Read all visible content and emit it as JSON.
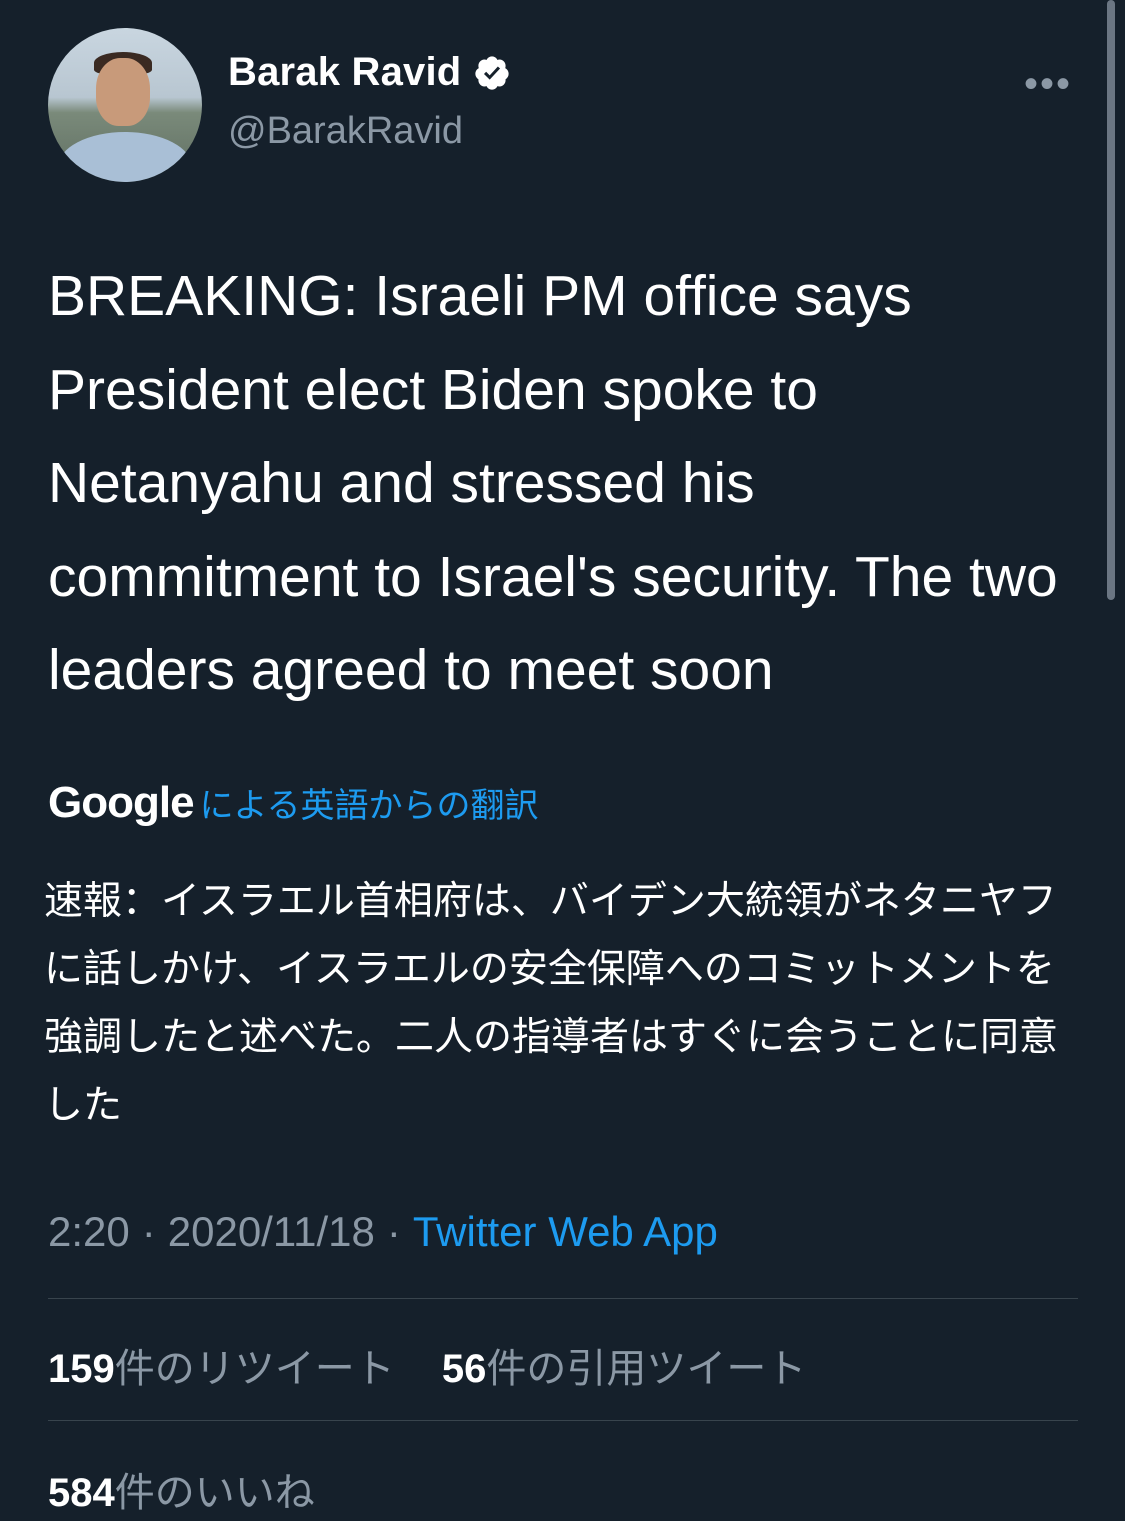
{
  "author": {
    "name": "Barak Ravid",
    "handle": "@BarakRavid"
  },
  "menu": {
    "more_label": "•••"
  },
  "tweet": {
    "text": "BREAKING: Israeli PM office says President elect Biden spoke to Netanyahu and stressed his commitment to Israel's security. The two leaders agreed to meet soon"
  },
  "translation": {
    "provider": "Google",
    "link_label": "による英語からの翻訳",
    "text": "速報：イスラエル首相府は、バイデン大統領がネタニヤフに話しかけ、イスラエルの安全保障へのコミットメントを強調したと述べた。二人の指導者はすぐに会うことに同意した"
  },
  "meta": {
    "time": "2:20",
    "date": "2020/11/18",
    "separator": "·",
    "source": "Twitter Web App"
  },
  "stats": {
    "retweets_count": "159",
    "retweets_label": "件のリツイート",
    "quotes_count": "56",
    "quotes_label": "件の引用ツイート",
    "likes_count": "584",
    "likes_label": "件のいいね"
  },
  "colors": {
    "background": "#15202b",
    "text": "#ffffff",
    "secondary": "#8b98a5",
    "accent": "#1d9bf0",
    "divider": "#38444d"
  }
}
